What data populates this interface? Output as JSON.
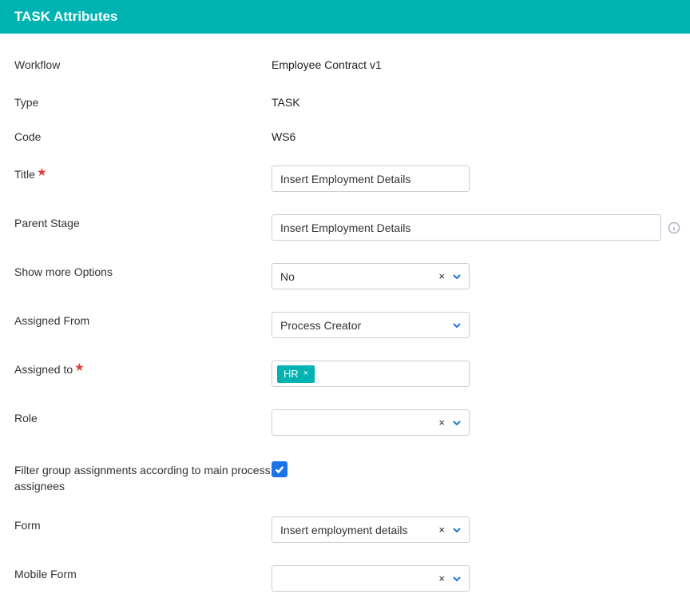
{
  "header": {
    "title": "TASK Attributes"
  },
  "labels": {
    "workflow": "Workflow",
    "type": "Type",
    "code": "Code",
    "title": "Title",
    "parent_stage": "Parent Stage",
    "show_more_options": "Show more Options",
    "assigned_from": "Assigned From",
    "assigned_to": "Assigned to",
    "role": "Role",
    "filter_group": "Filter group assignments according to main process assignees",
    "form": "Form",
    "mobile_form": "Mobile Form"
  },
  "values": {
    "workflow": "Employee Contract v1",
    "type": "TASK",
    "code": "WS6",
    "title": "Insert Employment Details",
    "parent_stage": "Insert Employment Details",
    "show_more_options": "No",
    "assigned_from": "Process Creator",
    "assigned_to_tag": "HR",
    "role": "",
    "filter_group_checked": true,
    "form": "Insert employment details",
    "mobile_form": ""
  }
}
